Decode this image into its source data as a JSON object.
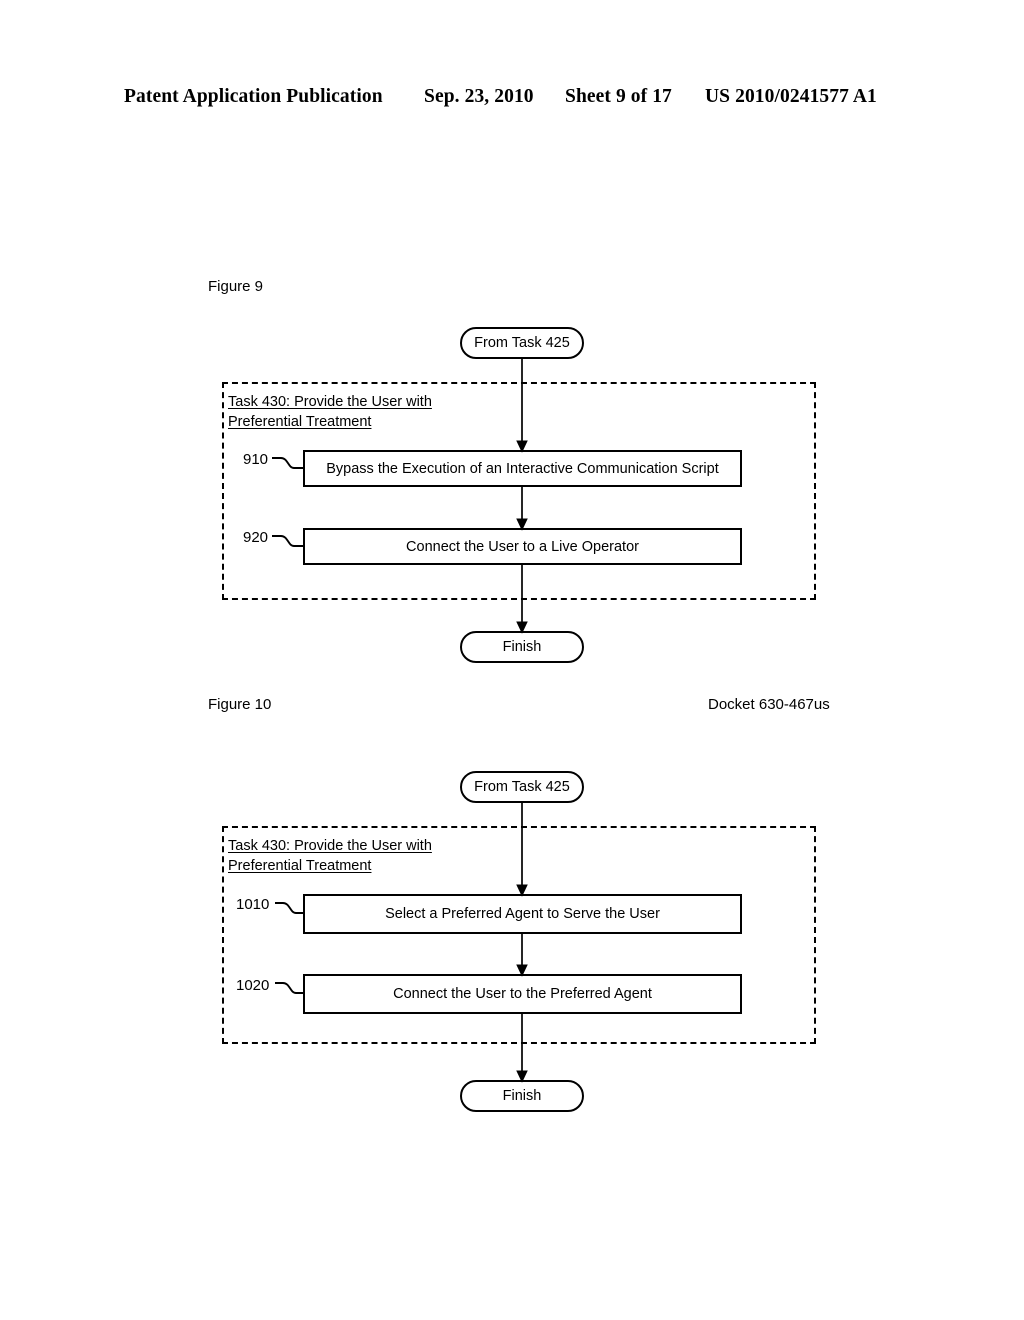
{
  "header": {
    "publication": "Patent Application Publication",
    "date": "Sep. 23, 2010",
    "sheet": "Sheet 9 of 17",
    "patent_number": "US 2010/0241577 A1"
  },
  "docket": "Docket 630-467us",
  "figures": [
    {
      "caption": "Figure 9",
      "start_terminal": "From Task 425",
      "end_terminal": "Finish",
      "group_title_line1": "Task 430: Provide the User with",
      "group_title_line2": "Preferential Treatment",
      "steps": [
        {
          "ref": "910",
          "label": "Bypass the Execution of an Interactive Communication Script"
        },
        {
          "ref": "920",
          "label": "Connect the User to a Live Operator"
        }
      ]
    },
    {
      "caption": "Figure 10",
      "start_terminal": "From Task 425",
      "end_terminal": "Finish",
      "group_title_line1": "Task 430: Provide the User with",
      "group_title_line2": "Preferential Treatment",
      "steps": [
        {
          "ref": "1010",
          "label": "Select a Preferred Agent to Serve the User"
        },
        {
          "ref": "1020",
          "label": "Connect the User to the Preferred Agent"
        }
      ]
    }
  ],
  "colors": {
    "ink": "#000000",
    "paper": "#ffffff"
  }
}
